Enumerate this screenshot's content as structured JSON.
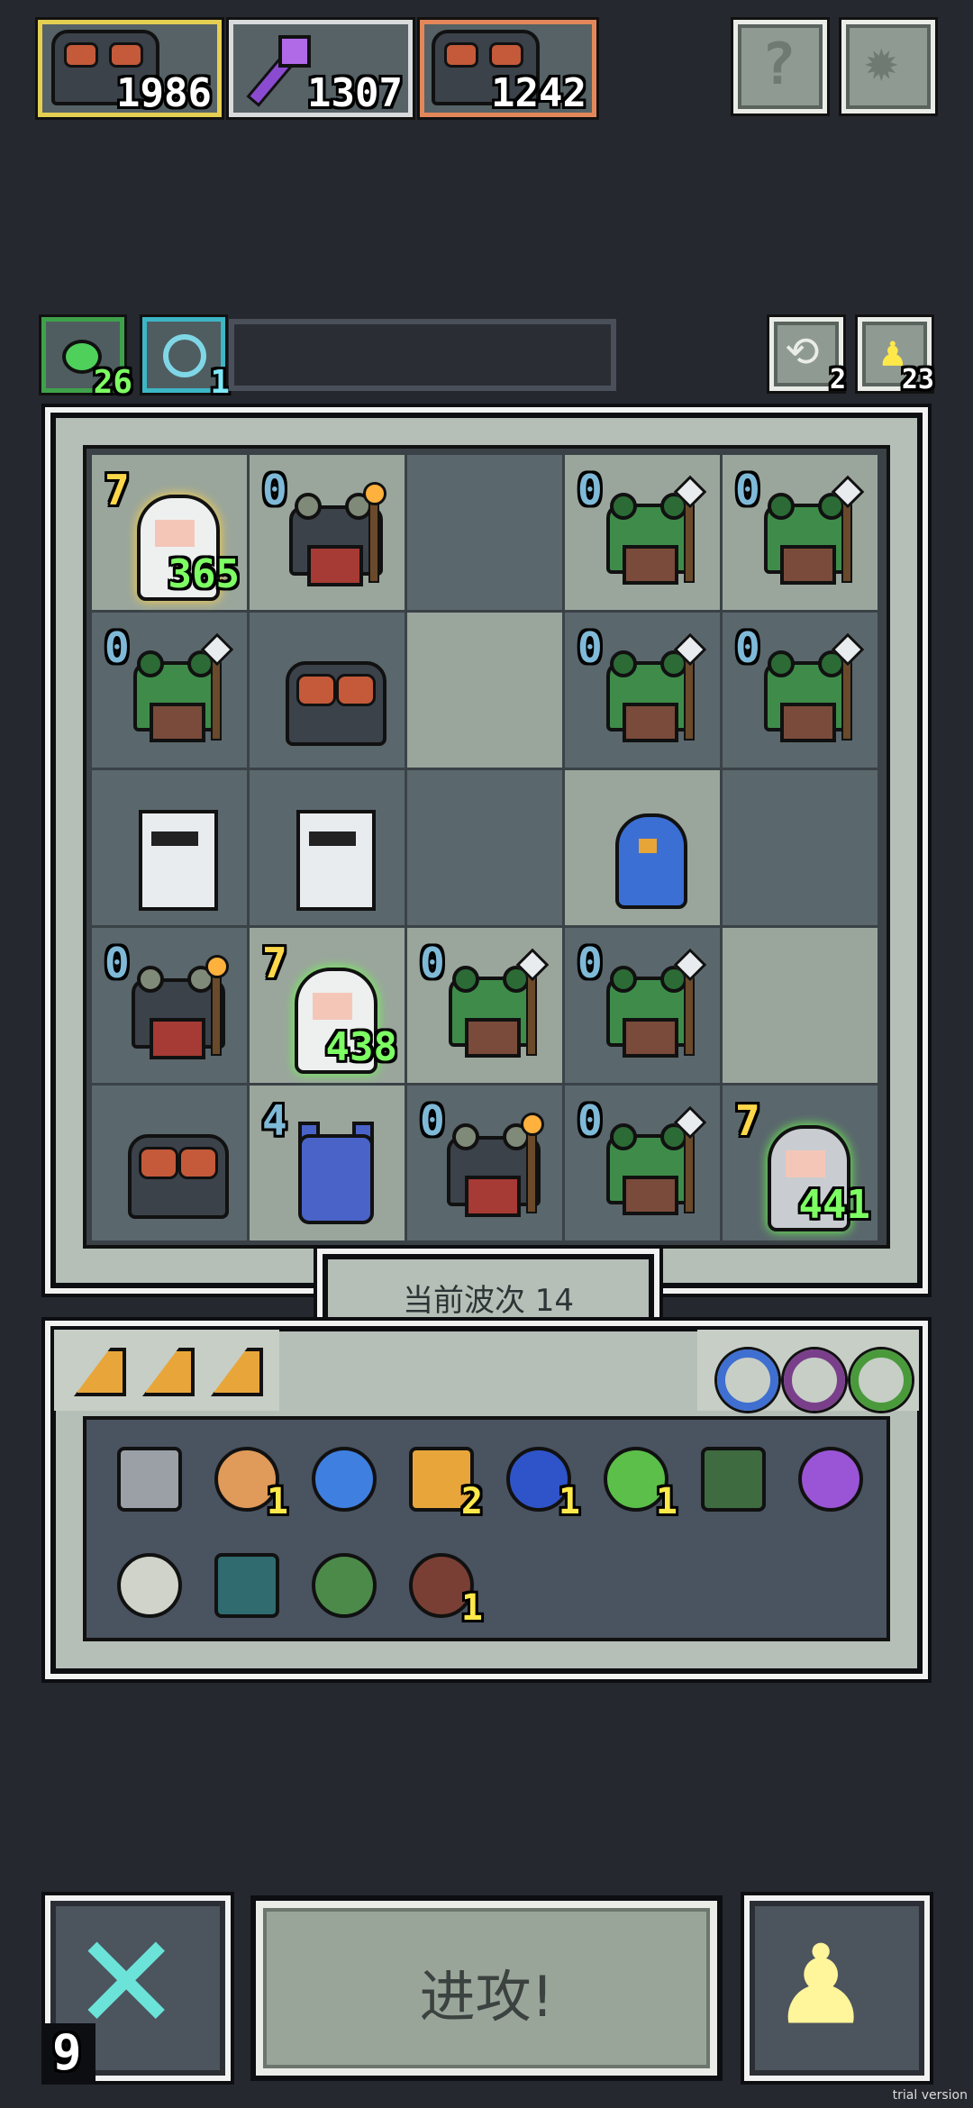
{
  "top_bar": {
    "cards": [
      {
        "name": "toad-card",
        "value": "1986",
        "border": "#e4cf52"
      },
      {
        "name": "staff-card",
        "value": "1307",
        "border": "#d8dadb"
      },
      {
        "name": "toad-card-2",
        "value": "1242",
        "border": "#e3875a"
      }
    ],
    "help_icon": "question-mark-icon",
    "settings_icon": "gear-icon"
  },
  "resources": {
    "green_count": "26",
    "timer_count": "1",
    "reroll_count": "2",
    "key_count": "23"
  },
  "board": {
    "cells": [
      {
        "unit": "hero-white",
        "level": "7",
        "hp": "365",
        "light": true,
        "glow": "gold"
      },
      {
        "unit": "frog-dark",
        "level": "0",
        "light": true
      },
      {
        "unit": "",
        "light": false
      },
      {
        "unit": "frog-green",
        "level": "0",
        "light": true
      },
      {
        "unit": "frog-green",
        "level": "0",
        "light": true
      },
      {
        "unit": "frog-green",
        "level": "0",
        "light": false
      },
      {
        "unit": "toad",
        "light": false
      },
      {
        "unit": "",
        "light": true
      },
      {
        "unit": "frog-green",
        "level": "0",
        "light": false
      },
      {
        "unit": "frog-green",
        "level": "0",
        "light": false
      },
      {
        "unit": "knight",
        "light": false
      },
      {
        "unit": "knight",
        "light": false
      },
      {
        "unit": "",
        "light": false
      },
      {
        "unit": "bird",
        "light": true
      },
      {
        "unit": "",
        "light": false
      },
      {
        "unit": "frog-dark",
        "level": "0",
        "light": false
      },
      {
        "unit": "hero-white",
        "level": "7",
        "hp": "438",
        "light": true,
        "glow": "green"
      },
      {
        "unit": "frog-green",
        "level": "0",
        "light": true
      },
      {
        "unit": "frog-green",
        "level": "0",
        "light": false
      },
      {
        "unit": "",
        "light": true
      },
      {
        "unit": "toad",
        "light": false
      },
      {
        "unit": "demon",
        "level": "4",
        "light": true
      },
      {
        "unit": "frog-dark",
        "level": "0",
        "light": false
      },
      {
        "unit": "frog-green",
        "level": "0",
        "light": false
      },
      {
        "unit": "hero-grey",
        "level": "7",
        "hp": "441",
        "light": false,
        "glow": "green"
      }
    ]
  },
  "wave_label": "当前波次 14",
  "inventory": {
    "slices": [
      "cheese-icon",
      "cheese-icon",
      "cheese-icon"
    ],
    "rings": [
      {
        "name": "blue-ring-icon",
        "color": "#3f6fd0"
      },
      {
        "name": "purple-ring-icon",
        "color": "#7a3f8a"
      },
      {
        "name": "green-ring-icon",
        "color": "#4a9a3c"
      }
    ],
    "items": [
      {
        "name": "hammer-icon",
        "count": ""
      },
      {
        "name": "lantern-icon",
        "count": "1"
      },
      {
        "name": "blue-wisp-icon",
        "count": ""
      },
      {
        "name": "eye-orb-icon",
        "count": "2"
      },
      {
        "name": "hourglass-icon",
        "count": "1"
      },
      {
        "name": "green-spirit-icon",
        "count": "1"
      },
      {
        "name": "rock-moss-icon",
        "count": ""
      },
      {
        "name": "purple-staff-icon",
        "count": ""
      },
      {
        "name": "device-icon",
        "count": ""
      },
      {
        "name": "dark-leaf-icon",
        "count": ""
      },
      {
        "name": "arrow-icon",
        "count": ""
      },
      {
        "name": "totem-icon",
        "count": "1"
      }
    ]
  },
  "bottom": {
    "close_count": "9",
    "attack_label": "进攻!",
    "pawn_icon": "pawn-icon"
  },
  "watermark": "trial version"
}
